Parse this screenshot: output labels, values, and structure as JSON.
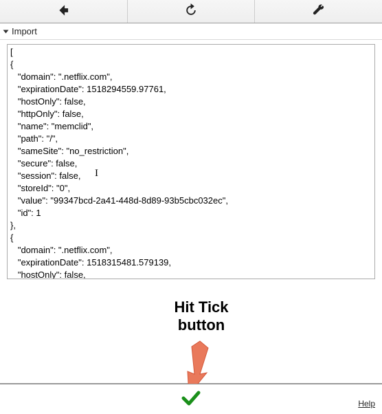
{
  "section": {
    "title": "Import"
  },
  "editor": {
    "text": "[\n{\n   \"domain\": \".netflix.com\",\n   \"expirationDate\": 1518294559.97761,\n   \"hostOnly\": false,\n   \"httpOnly\": false,\n   \"name\": \"memclid\",\n   \"path\": \"/\",\n   \"sameSite\": \"no_restriction\",\n   \"secure\": false,\n   \"session\": false,\n   \"storeId\": \"0\",\n   \"value\": \"99347bcd-2a41-448d-8d89-93b5cbc032ec\",\n   \"id\": 1\n},\n{\n   \"domain\": \".netflix.com\",\n   \"expirationDate\": 1518315481.579139,\n   \"hostOnly\": false,\n   \"httpOnly\": true,"
  },
  "annotation": {
    "line1": "Hit Tick",
    "line2": "button"
  },
  "footer": {
    "help": "Help"
  },
  "colors": {
    "tick": "#1a8f1a",
    "arrow": "#e9795b"
  }
}
